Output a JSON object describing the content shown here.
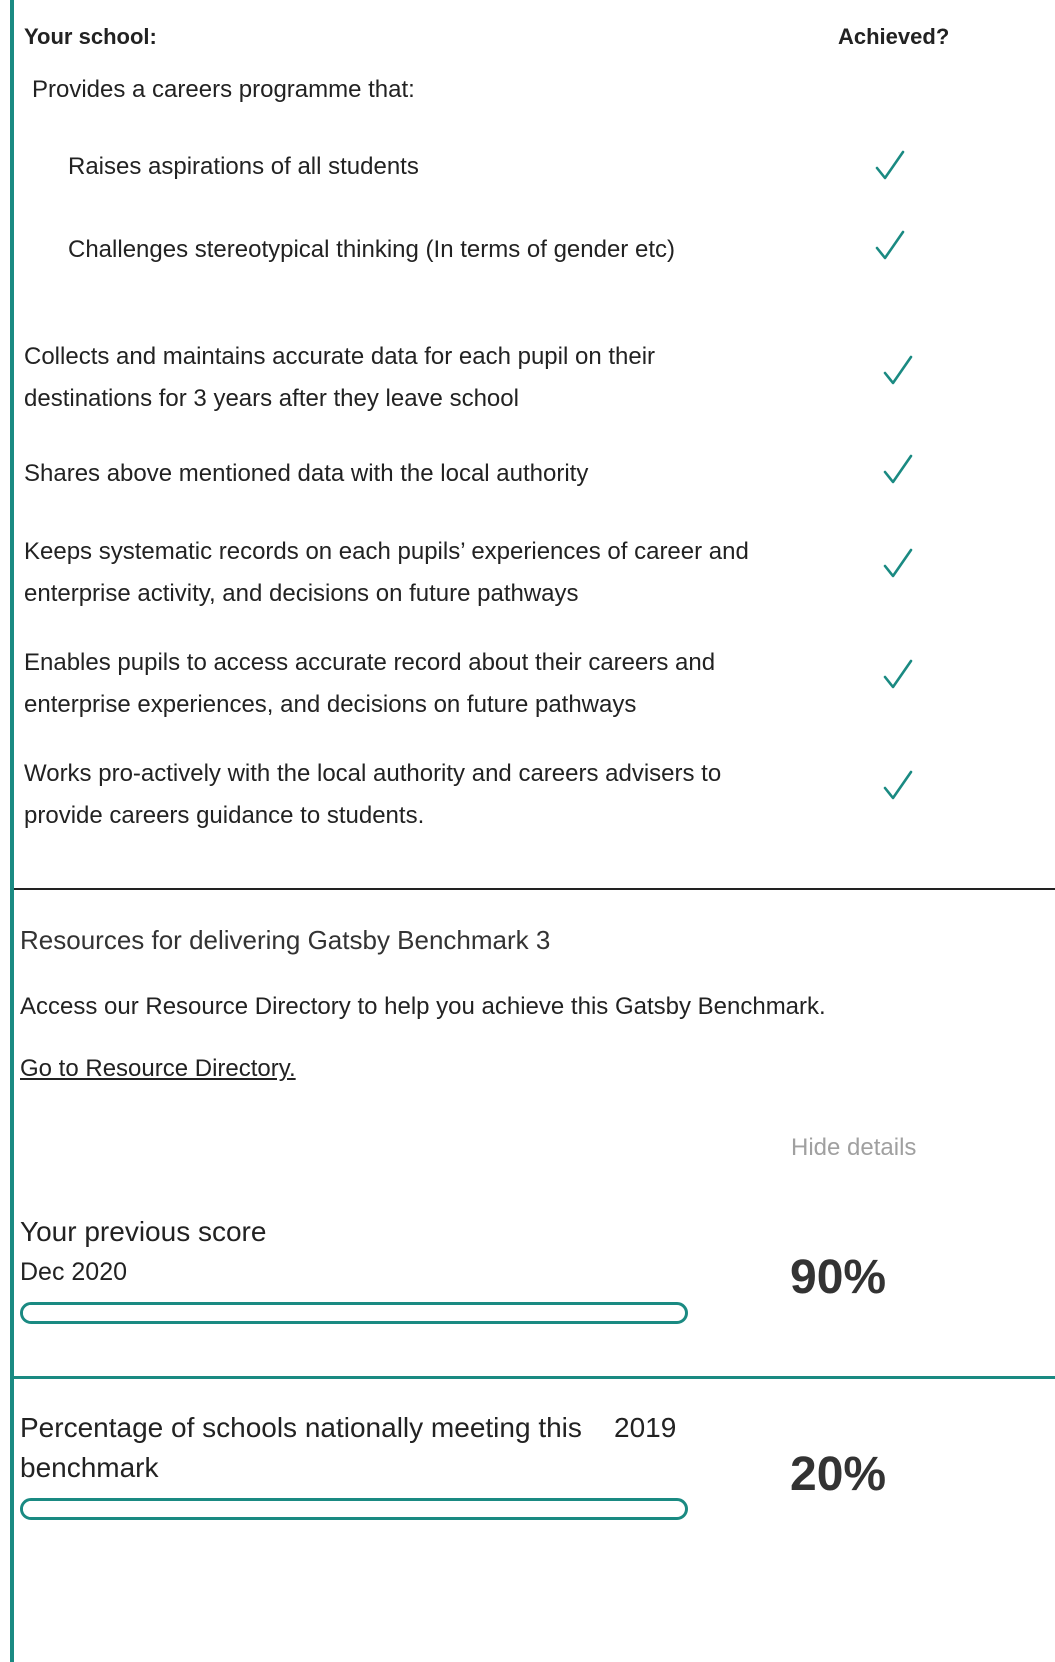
{
  "header": {
    "left": "Your school:",
    "right": "Achieved?"
  },
  "intro": "Provides a careers programme that:",
  "items": [
    {
      "lines": [
        "Raises aspirations of all students"
      ],
      "achieved": true
    },
    {
      "lines": [
        "Challenges stereotypical thinking (In terms of gender etc)"
      ],
      "achieved": true
    },
    {
      "lines": [
        "Collects and maintains accurate data for each pupil on their",
        "destinations for 3 years after they leave school"
      ],
      "achieved": true
    },
    {
      "lines": [
        "Shares above mentioned data with the local authority"
      ],
      "achieved": true
    },
    {
      "lines": [
        "Keeps systematic records on each pupils’ experiences of career and",
        "enterprise activity, and decisions on future pathways"
      ],
      "achieved": true
    },
    {
      "lines": [
        "Enables pupils to access accurate record about their careers and",
        "enterprise experiences, and decisions on future pathways"
      ],
      "achieved": true
    },
    {
      "lines": [
        "Works pro-actively with the local authority and careers advisers to",
        "provide careers guidance to students."
      ],
      "achieved": true
    }
  ],
  "resources": {
    "title": "Resources for delivering Gatsby Benchmark 3",
    "body": "Access our Resource Directory to help you achieve this Gatsby Benchmark.",
    "link": "Go to Resource Directory."
  },
  "hide_details": "Hide details",
  "previous_score": {
    "label": "Your previous score",
    "date": "Dec 2020",
    "value_text": "90%",
    "value": 90
  },
  "national": {
    "label_line1": "Percentage of schools nationally meeting this",
    "label_line2": "benchmark",
    "year": "2019",
    "value_text": "20%",
    "value": 20
  },
  "colors": {
    "accent": "#1a8a82",
    "check": "#1a8a82",
    "muted": "#a0a0a0"
  }
}
